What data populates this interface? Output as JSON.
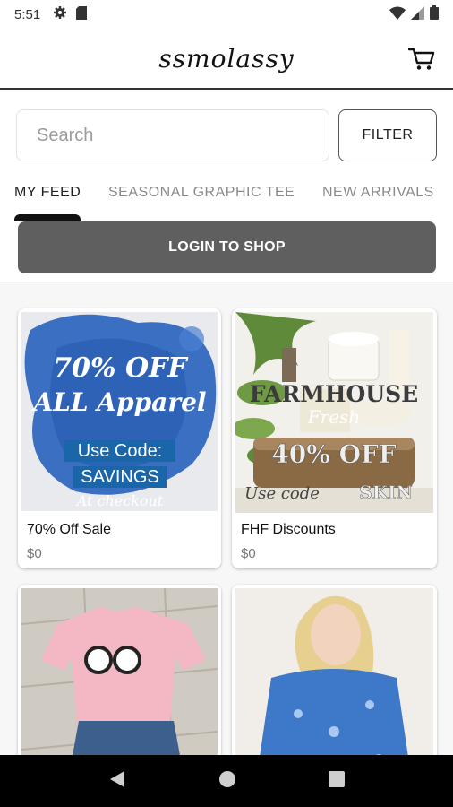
{
  "status_bar": {
    "time": "5:51"
  },
  "app": {
    "title": "ssmolassy"
  },
  "search": {
    "placeholder": "Search"
  },
  "filter_label": "FILTER",
  "tabs": [
    {
      "label": "MY FEED",
      "active": true
    },
    {
      "label": "SEASONAL GRAPHIC TEE",
      "active": false
    },
    {
      "label": "NEW ARRIVALS",
      "active": false
    }
  ],
  "login_label": "LOGIN TO SHOP",
  "products": [
    {
      "name": "70% Off Sale",
      "price": "$0",
      "image_text": [
        "70% OFF",
        "ALL Apparel",
        "Use Code:",
        "SAVINGS",
        "At checkout"
      ]
    },
    {
      "name": "FHF Discounts",
      "price": "$0",
      "image_text": [
        "FARMHOUSE",
        "Fresh",
        "40% OFF",
        "Use code",
        "SKIN"
      ]
    },
    {
      "name": "",
      "price": ""
    },
    {
      "name": "",
      "price": ""
    }
  ],
  "colors": {
    "accent": "#5f5f5f",
    "tab_active": "#222222",
    "tab_inactive": "#8a8a8a",
    "nav_bg": "#000000"
  },
  "icons": [
    "gear-icon",
    "sd-card-icon",
    "wifi-icon",
    "signal-icon",
    "battery-icon",
    "cart-icon",
    "back-icon",
    "home-icon",
    "recents-icon"
  ]
}
